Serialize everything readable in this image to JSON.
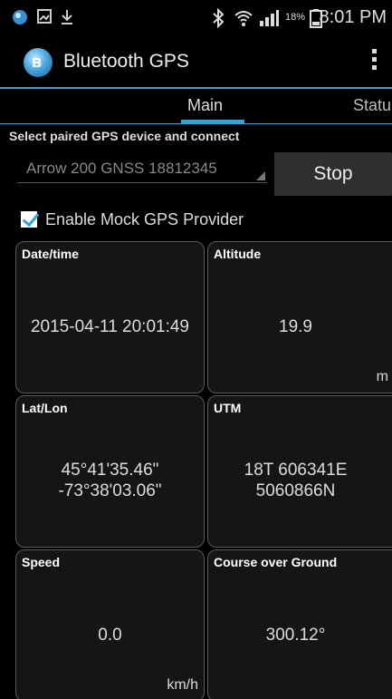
{
  "status_bar": {
    "battery_percent": "18%",
    "time": "8:01 PM"
  },
  "action_bar": {
    "title": "Bluetooth GPS"
  },
  "tabs": [
    {
      "label": "Main"
    },
    {
      "label": "Statu"
    }
  ],
  "connect": {
    "section_label": "Select paired GPS device and connect",
    "selected_device": "Arrow 200 GNSS 18812345",
    "stop_label": "Stop"
  },
  "mock_provider": {
    "label": "Enable Mock GPS Provider",
    "checked": true
  },
  "cards": {
    "datetime": {
      "title": "Date/time",
      "value": "2015-04-11 20:01:49"
    },
    "altitude": {
      "title": "Altitude",
      "value": "19.9",
      "unit": "m"
    },
    "latlon": {
      "title": "Lat/Lon",
      "lat": "45°41'35.46\"",
      "lon": "-73°38'03.06\""
    },
    "utm": {
      "title": "UTM",
      "line1": "18T 606341E",
      "line2": "5060866N"
    },
    "speed": {
      "title": "Speed",
      "value": "0.0",
      "unit": "km/h"
    },
    "course": {
      "title": "Course over Ground",
      "value": "300.12°"
    }
  },
  "colors": {
    "accent": "#33a3d1",
    "background": "#000000",
    "card_background": "#151515"
  }
}
